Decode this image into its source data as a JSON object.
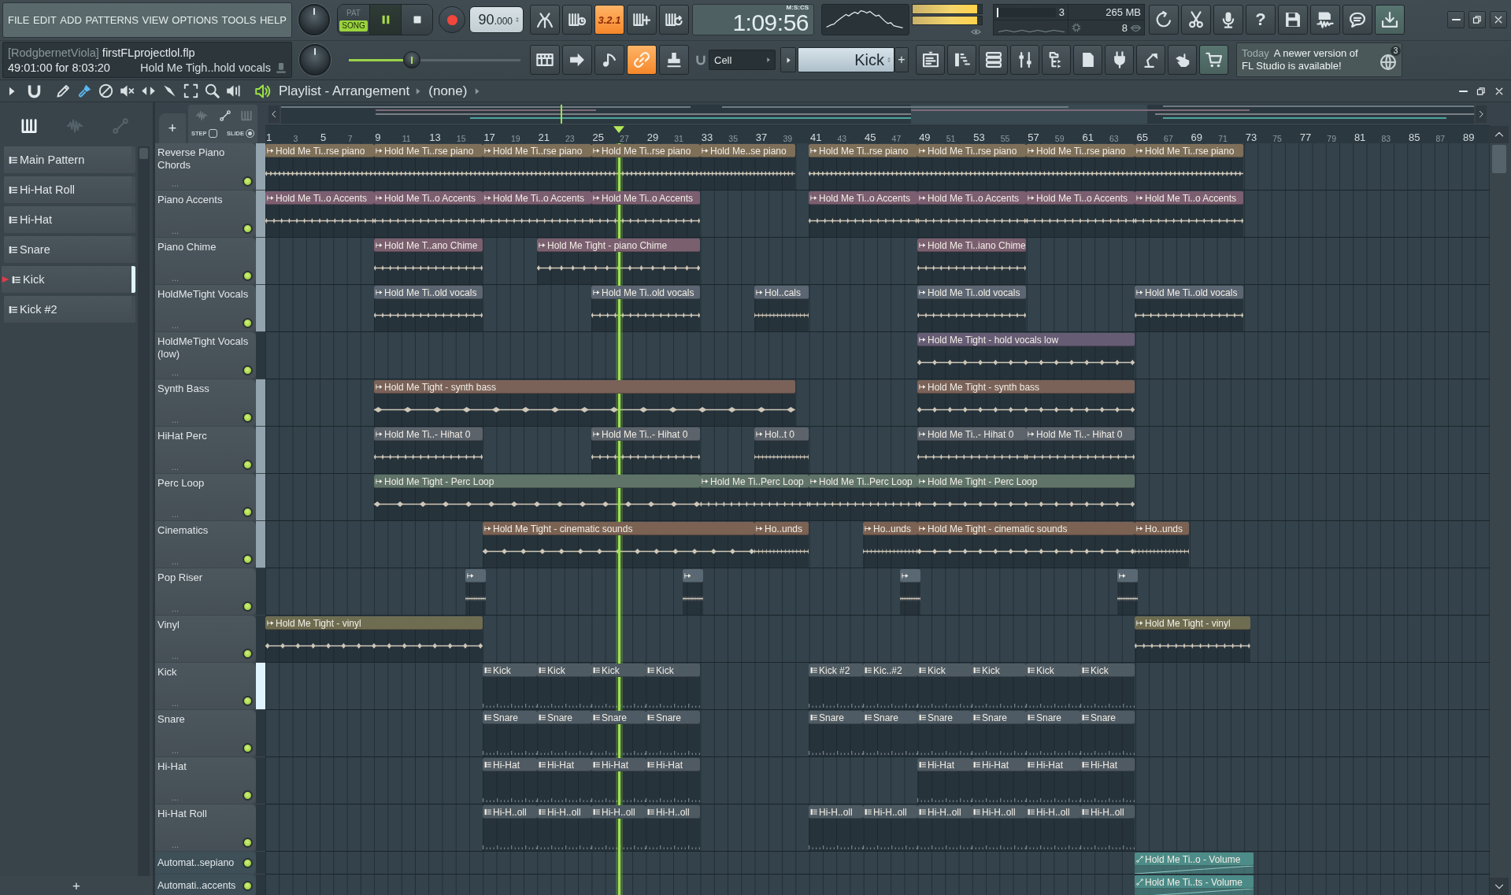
{
  "menu": [
    "FILE",
    "EDIT",
    "ADD",
    "PATTERNS",
    "VIEW",
    "OPTIONS",
    "TOOLS",
    "HELP"
  ],
  "transport": {
    "modes": [
      {
        "label": "PAT",
        "selected": false
      },
      {
        "label": "SONG",
        "selected": true
      }
    ],
    "playing": true,
    "tempo": "90",
    "tempo_decimals": ".000"
  },
  "record_tools": [
    {
      "kind": "metronome",
      "on": false
    },
    {
      "kind": "wait",
      "on": false
    },
    {
      "kind": "countdown",
      "label": "3.2.1",
      "on": true
    },
    {
      "kind": "step",
      "on": false
    },
    {
      "kind": "loop",
      "on": false
    }
  ],
  "clock": {
    "time": "1:09:56",
    "format": "M:S:CS"
  },
  "peak": [
    {
      "level": 0.93
    },
    {
      "level": 0.93
    }
  ],
  "monitor": {
    "cpu": "3",
    "cpu_meter": {
      "level": 0.02
    },
    "memory": "265 MB",
    "polyphony": "8"
  },
  "toolbar_buttons": [
    {
      "kind": "undo",
      "on": false
    },
    {
      "kind": "cut",
      "on": false
    },
    {
      "kind": "mic",
      "on": false
    },
    {
      "kind": "help",
      "label": "?",
      "on": false
    },
    {
      "kind": "save",
      "on": false
    },
    {
      "kind": "render",
      "on": false
    },
    {
      "kind": "chat",
      "on": false
    },
    {
      "kind": "download",
      "on": true
    }
  ],
  "info": {
    "user": "[RodgbernetViola]",
    "file": "firstFLprojectlol.flp",
    "time": "49:01:00 for 8:03:20",
    "hint": "Hold Me Tigh..hold vocals"
  },
  "slider": {
    "level": 0.35
  },
  "view_tools": [
    {
      "kind": "typing-keyboard",
      "on": false
    },
    {
      "kind": "arrow",
      "on": false
    },
    {
      "kind": "note",
      "on": false
    },
    {
      "kind": "link",
      "on": true
    },
    {
      "kind": "stamp",
      "on": false
    }
  ],
  "snap": "Cell",
  "pattern_picker": {
    "value": "Kick",
    "add": "+"
  },
  "window_tools": [
    {
      "kind": "playlist",
      "on": false
    },
    {
      "kind": "step-sequencer",
      "on": false
    },
    {
      "kind": "channel-rack",
      "on": false
    },
    {
      "kind": "mixer",
      "on": false
    },
    {
      "kind": "browser",
      "on": false
    },
    {
      "kind": "page",
      "on": false
    },
    {
      "kind": "plugin",
      "on": false
    },
    {
      "kind": "lamp",
      "on": false
    },
    {
      "kind": "hand",
      "on": false
    },
    {
      "kind": "cart",
      "on": true
    }
  ],
  "news": {
    "date": "Today",
    "text": "A newer version of FL Studio is available!",
    "count": "3"
  },
  "playlist": {
    "title": "Playlist - Arrangement",
    "arrangement": "(none)",
    "tools": [
      {
        "kind": "draw",
        "selected": false
      },
      {
        "kind": "paint",
        "selected": true
      },
      {
        "kind": "delete",
        "selected": false
      },
      {
        "kind": "mute",
        "selected": false
      },
      {
        "kind": "slip",
        "selected": false
      },
      {
        "kind": "slice",
        "selected": false
      },
      {
        "kind": "select",
        "selected": false
      },
      {
        "kind": "zoom",
        "selected": false
      },
      {
        "kind": "playback",
        "selected": false
      }
    ]
  },
  "browser": {
    "tabs": [
      {
        "kind": "patterns",
        "selected": true
      },
      {
        "kind": "audio",
        "selected": false
      },
      {
        "kind": "automation",
        "selected": false
      }
    ],
    "items": [
      {
        "name": "Main Pattern",
        "selected": false
      },
      {
        "name": "Hi-Hat Roll",
        "selected": false
      },
      {
        "name": "Hi-Hat",
        "selected": false
      },
      {
        "name": "Snare",
        "selected": false
      },
      {
        "name": "Kick",
        "selected": true
      },
      {
        "name": "Kick #2",
        "selected": false
      }
    ],
    "add": "+"
  },
  "header": {
    "add": "+",
    "modes": [
      {
        "label": "STEP",
        "selected": false
      },
      {
        "label": "SLIDE",
        "selected": true
      }
    ]
  },
  "ruler": [
    "1",
    "3",
    "5",
    "7",
    "9",
    "11",
    "13",
    "15",
    "17",
    "19",
    "21",
    "23",
    "25",
    "27",
    "29",
    "31",
    "33",
    "35",
    "37",
    "39",
    "41",
    "43",
    "45",
    "47",
    "49",
    "51",
    "53",
    "55",
    "57",
    "59",
    "61",
    "63",
    "65",
    "67",
    "69",
    "71",
    "73",
    "75",
    "77",
    "79",
    "81",
    "83",
    "85",
    "87",
    "89"
  ],
  "tracks": [
    {
      "kind": "lane",
      "name": "Reverse Piano Chords",
      "more": "...",
      "on": true,
      "selected": true,
      "focused": false,
      "color": "#7e6f59",
      "clips": [
        {
          "kind": "audio",
          "name": "Hold Me Ti..rse piano"
        },
        {
          "kind": "audio",
          "name": "Hold Me Ti..rse piano"
        },
        {
          "kind": "audio",
          "name": "Hold Me Ti..rse piano"
        },
        {
          "kind": "audio",
          "name": "Hold Me Ti..rse piano"
        },
        {
          "kind": "audio",
          "name": "Hold Me..se piano"
        },
        {
          "kind": "audio",
          "name": "Hold Me Ti..rse piano"
        },
        {
          "kind": "audio",
          "name": "Hold Me Ti..rse piano"
        },
        {
          "kind": "audio",
          "name": "Hold Me Ti..rse piano"
        },
        {
          "kind": "audio",
          "name": "Hold Me Ti..rse piano"
        }
      ]
    },
    {
      "kind": "lane",
      "name": "Piano Accents",
      "more": "...",
      "on": true,
      "selected": true,
      "focused": false,
      "color": "#7b5e70",
      "clips": [
        {
          "kind": "audio",
          "name": "Hold Me Ti..o Accents"
        },
        {
          "kind": "audio",
          "name": "Hold Me Ti..o Accents"
        },
        {
          "kind": "audio",
          "name": "Hold Me Ti..o Accents"
        },
        {
          "kind": "audio",
          "name": "Hold Me Ti..o Accents"
        },
        {
          "kind": "audio",
          "name": "Hold Me Ti..o Accents"
        },
        {
          "kind": "audio",
          "name": "Hold Me Ti..o Accents"
        },
        {
          "kind": "audio",
          "name": "Hold Me Ti..o Accents"
        },
        {
          "kind": "audio",
          "name": "Hold Me Ti..o Accents"
        }
      ]
    },
    {
      "kind": "lane",
      "name": "Piano Chime",
      "more": "...",
      "on": true,
      "selected": true,
      "focused": false,
      "color": "#7a5f6f",
      "clips": [
        {
          "kind": "audio",
          "name": "Hold Me T..ano Chime"
        },
        {
          "kind": "audio",
          "name": "Hold Me Tight - piano Chime"
        },
        {
          "kind": "audio",
          "name": "Hold Me Ti..iano Chime"
        }
      ]
    },
    {
      "kind": "lane",
      "name": "HoldMeTight Vocals",
      "more": "...",
      "on": true,
      "selected": true,
      "focused": false,
      "color": "#5c6672",
      "clips": [
        {
          "kind": "audio",
          "name": "Hold Me Ti..old vocals"
        },
        {
          "kind": "audio",
          "name": "Hold Me Ti..old vocals"
        },
        {
          "kind": "audio",
          "name": "Hol..cals"
        },
        {
          "kind": "audio",
          "name": "Hold Me Ti..old vocals"
        },
        {
          "kind": "audio",
          "name": "Hold Me Ti..old vocals"
        }
      ]
    },
    {
      "kind": "lane",
      "name": "HoldMeTight Vocals (low)",
      "more": "...",
      "on": true,
      "selected": false,
      "focused": false,
      "color": "#665c74",
      "clips": [
        {
          "kind": "audio",
          "name": "Hold Me Tight - hold vocals low"
        }
      ]
    },
    {
      "kind": "lane",
      "name": "Synth Bass",
      "more": "...",
      "on": true,
      "selected": true,
      "focused": false,
      "color": "#7a6258",
      "clips": [
        {
          "kind": "audio",
          "name": "Hold Me Tight - synth bass"
        },
        {
          "kind": "audio",
          "name": "Hold Me Tight - synth bass"
        }
      ]
    },
    {
      "kind": "lane",
      "name": "HiHat Perc",
      "more": "...",
      "on": true,
      "selected": true,
      "focused": false,
      "color": "#5c636b",
      "clips": [
        {
          "kind": "audio",
          "name": "Hold Me Ti..- Hihat 0"
        },
        {
          "kind": "audio",
          "name": "Hold Me Ti..- Hihat 0"
        },
        {
          "kind": "audio",
          "name": "Hol..t 0"
        },
        {
          "kind": "audio",
          "name": "Hold Me Ti..- Hihat 0"
        },
        {
          "kind": "audio",
          "name": "Hold Me Ti..- Hihat 0"
        }
      ]
    },
    {
      "kind": "lane",
      "name": "Perc Loop",
      "more": "...",
      "on": true,
      "selected": true,
      "focused": false,
      "color": "#5f7369",
      "clips": [
        {
          "kind": "audio",
          "name": "Hold Me Tight - Perc Loop"
        },
        {
          "kind": "audio",
          "name": "Hold Me Ti..Perc Loop"
        },
        {
          "kind": "audio",
          "name": "Hold Me Ti..Perc Loop"
        },
        {
          "kind": "audio",
          "name": "Hold Me Tight - Perc Loop"
        }
      ]
    },
    {
      "kind": "lane",
      "name": "Cinematics",
      "more": "...",
      "on": true,
      "selected": true,
      "focused": false,
      "color": "#7b6253",
      "clips": [
        {
          "kind": "audio",
          "name": "Hold Me Tight - cinematic sounds"
        },
        {
          "kind": "audio",
          "name": "Ho..unds"
        },
        {
          "kind": "audio",
          "name": "Ho..unds"
        },
        {
          "kind": "audio",
          "name": "Hold Me Tight - cinematic sounds"
        },
        {
          "kind": "audio",
          "name": "Ho..unds"
        }
      ]
    },
    {
      "kind": "lane",
      "name": "Pop Riser",
      "more": "...",
      "on": true,
      "selected": false,
      "focused": false,
      "color": "#5a6873",
      "clips": [
        {
          "kind": "audio"
        },
        {
          "kind": "audio"
        },
        {
          "kind": "audio"
        },
        {
          "kind": "audio"
        }
      ]
    },
    {
      "kind": "lane",
      "name": "Vinyl",
      "more": "...",
      "on": true,
      "selected": false,
      "focused": false,
      "color": "#6f6d51",
      "clips": [
        {
          "kind": "audio",
          "name": "Hold Me Tight - vinyl"
        },
        {
          "kind": "audio",
          "name": "Hold Me Tight - vinyl"
        }
      ]
    },
    {
      "kind": "lane",
      "name": "Kick",
      "more": "...",
      "on": true,
      "selected": false,
      "focused": true,
      "color": "#4f5b63",
      "clips": [
        {
          "kind": "pattern",
          "name": "Kick"
        },
        {
          "kind": "pattern",
          "name": "Kick"
        },
        {
          "kind": "pattern",
          "name": "Kick"
        },
        {
          "kind": "pattern",
          "name": "Kick"
        },
        {
          "kind": "pattern",
          "name": "Kick #2"
        },
        {
          "kind": "pattern",
          "name": "Kic..#2"
        },
        {
          "kind": "pattern",
          "name": "Kick"
        },
        {
          "kind": "pattern",
          "name": "Kick"
        },
        {
          "kind": "pattern",
          "name": "Kick"
        },
        {
          "kind": "pattern",
          "name": "Kick"
        }
      ]
    },
    {
      "kind": "lane",
      "name": "Snare",
      "more": "...",
      "on": true,
      "selected": false,
      "focused": false,
      "color": "#4f5b64",
      "clips": [
        {
          "kind": "pattern",
          "name": "Snare"
        },
        {
          "kind": "pattern",
          "name": "Snare"
        },
        {
          "kind": "pattern",
          "name": "Snare"
        },
        {
          "kind": "pattern",
          "name": "Snare"
        },
        {
          "kind": "pattern",
          "name": "Snare"
        },
        {
          "kind": "pattern",
          "name": "Snare"
        },
        {
          "kind": "pattern",
          "name": "Snare"
        },
        {
          "kind": "pattern",
          "name": "Snare"
        },
        {
          "kind": "pattern",
          "name": "Snare"
        },
        {
          "kind": "pattern",
          "name": "Snare"
        }
      ]
    },
    {
      "kind": "lane",
      "name": "Hi-Hat",
      "more": "...",
      "on": true,
      "selected": false,
      "focused": false,
      "color": "#4f5a63",
      "clips": [
        {
          "kind": "pattern",
          "name": "Hi-Hat"
        },
        {
          "kind": "pattern",
          "name": "Hi-Hat"
        },
        {
          "kind": "pattern",
          "name": "Hi-Hat"
        },
        {
          "kind": "pattern",
          "name": "Hi-Hat"
        },
        {
          "kind": "pattern",
          "name": "Hi-Hat"
        },
        {
          "kind": "pattern",
          "name": "Hi-Hat"
        },
        {
          "kind": "pattern",
          "name": "Hi-Hat"
        },
        {
          "kind": "pattern",
          "name": "Hi-Hat"
        }
      ]
    },
    {
      "kind": "lane",
      "name": "Hi-Hat Roll",
      "more": "...",
      "on": true,
      "selected": false,
      "focused": false,
      "color": "#4e5a62",
      "clips": [
        {
          "kind": "pattern",
          "name": "Hi-H..oll"
        },
        {
          "kind": "pattern",
          "name": "Hi-H..oll"
        },
        {
          "kind": "pattern",
          "name": "Hi-H..oll"
        },
        {
          "kind": "pattern",
          "name": "Hi-H..oll"
        },
        {
          "kind": "pattern",
          "name": "Hi-H..oll"
        },
        {
          "kind": "pattern",
          "name": "Hi-H..oll"
        },
        {
          "kind": "pattern",
          "name": "Hi-H..oll"
        },
        {
          "kind": "pattern",
          "name": "Hi-H..oll"
        },
        {
          "kind": "pattern",
          "name": "Hi-H..oll"
        },
        {
          "kind": "pattern",
          "name": "Hi-H..oll"
        }
      ]
    },
    {
      "kind": "automation",
      "name": "Automat..sepiano",
      "on": true,
      "selected": false,
      "focused": false,
      "color": "#4d8c88",
      "clips": [
        {
          "kind": "automation",
          "name": "Hold Me Ti..o - Volume"
        }
      ]
    },
    {
      "kind": "automation",
      "name": "Automati..accents",
      "on": true,
      "selected": false,
      "focused": false,
      "color": "#4c8a87",
      "clips": [
        {
          "kind": "automation",
          "name": "Hold Me Ti..ts - Volume"
        }
      ]
    }
  ]
}
